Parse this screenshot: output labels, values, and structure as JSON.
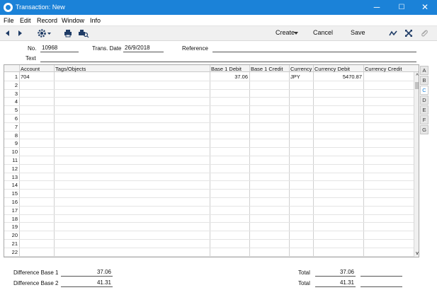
{
  "window": {
    "title": "Transaction: New",
    "min_glyph": "─",
    "max_glyph": "☐",
    "close_glyph": "✕"
  },
  "menu": [
    "File",
    "Edit",
    "Record",
    "Window",
    "Info"
  ],
  "toolbar": {
    "create_label": "Create",
    "discard_label": "Cancel",
    "save_label": "Save",
    "icons": [
      "left-arrow-icon",
      "right-arrow-icon",
      "gear-icon",
      "print-icon",
      "print-preview-icon",
      "chart-icon",
      "expand-icon",
      "attachment-icon"
    ]
  },
  "header": {
    "no_label": "No.",
    "no_value": "10968",
    "date_label": "Trans. Date",
    "date_value": "26/9/2018",
    "reference_label": "Reference",
    "reference_value": "",
    "text_label": "Text",
    "text_value": ""
  },
  "grid": {
    "columns": [
      "Account",
      "Tags/Objects",
      "Base 1 Debit",
      "Base 1 Credit",
      "Currency",
      "Currency Debit",
      "Currency Credit"
    ],
    "rows": [
      {
        "n": "1",
        "account": "704",
        "tags": "",
        "b1debit": "37.06",
        "b1credit": "",
        "currency": "JPY",
        "cdebit": "5470.87",
        "ccredit": ""
      },
      {
        "n": "2"
      },
      {
        "n": "3"
      },
      {
        "n": "4"
      },
      {
        "n": "5"
      },
      {
        "n": "6"
      },
      {
        "n": "7"
      },
      {
        "n": "8"
      },
      {
        "n": "9"
      },
      {
        "n": "10"
      },
      {
        "n": "11"
      },
      {
        "n": "12"
      },
      {
        "n": "13"
      },
      {
        "n": "14"
      },
      {
        "n": "15"
      },
      {
        "n": "16"
      },
      {
        "n": "17"
      },
      {
        "n": "18"
      },
      {
        "n": "19"
      },
      {
        "n": "20"
      },
      {
        "n": "21"
      },
      {
        "n": "22"
      }
    ]
  },
  "side_tabs": [
    "A",
    "B",
    "C",
    "D",
    "E",
    "F",
    "G"
  ],
  "active_tab": "C",
  "footer": {
    "diff1_label": "Difference Base 1",
    "diff1_value": "37.06",
    "diff2_label": "Difference Base 2",
    "diff2_value": "41.31",
    "total_label": "Total",
    "total1_value": "37.06",
    "total2_value": "41.31"
  },
  "colors": {
    "titlebar": "#1b82d8",
    "active_tab_text": "#1b82d8"
  }
}
